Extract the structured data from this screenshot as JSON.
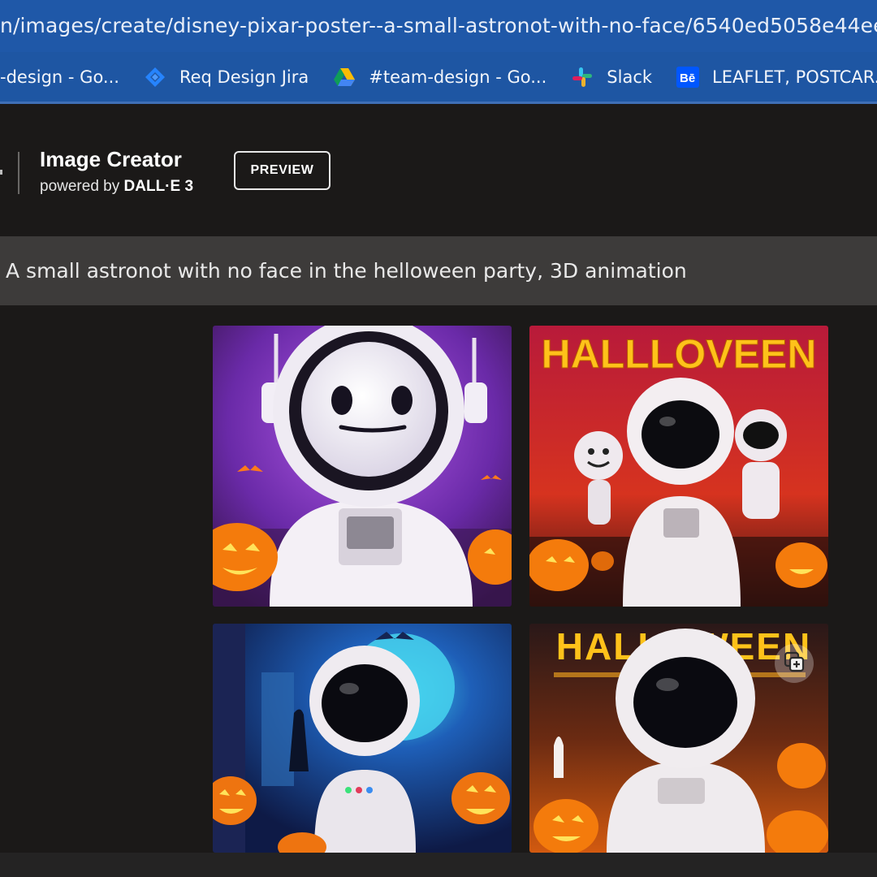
{
  "browser": {
    "url": "n/images/create/disney-pixar-poster--a-small-astronot-with-no-face/6540ed5058e44ee997023829",
    "bookmarks": [
      {
        "label": "-design - Go...",
        "icon": "google-docs-icon"
      },
      {
        "label": "Req Design Jira",
        "icon": "jira-icon"
      },
      {
        "label": "#team-design - Go...",
        "icon": "google-drive-icon"
      },
      {
        "label": "Slack",
        "icon": "slack-icon"
      },
      {
        "label": "LEAFLET, POSTCAR...",
        "icon": "behance-icon"
      },
      {
        "label": "",
        "icon": "youtube-icon"
      }
    ]
  },
  "app": {
    "title": "Image Creator",
    "subtitle_prefix": "powered by ",
    "subtitle_brand": "DALL·E 3",
    "preview_label": "PREVIEW"
  },
  "prompt": "A small astronot with no face in the helloween party, 3D animation",
  "results": {
    "tiles": [
      {
        "id": "result-image-1",
        "poster_text": ""
      },
      {
        "id": "result-image-2",
        "poster_text": "HALLLOVEEN"
      },
      {
        "id": "result-image-3",
        "poster_text": ""
      },
      {
        "id": "result-image-4",
        "poster_text": "HALLOWEEN"
      }
    ]
  },
  "colors": {
    "browser_bar": "#1f58a8",
    "page_bg": "#1b1918",
    "prompt_bg": "#3d3b3a",
    "poster_text": "#ffc21a"
  }
}
